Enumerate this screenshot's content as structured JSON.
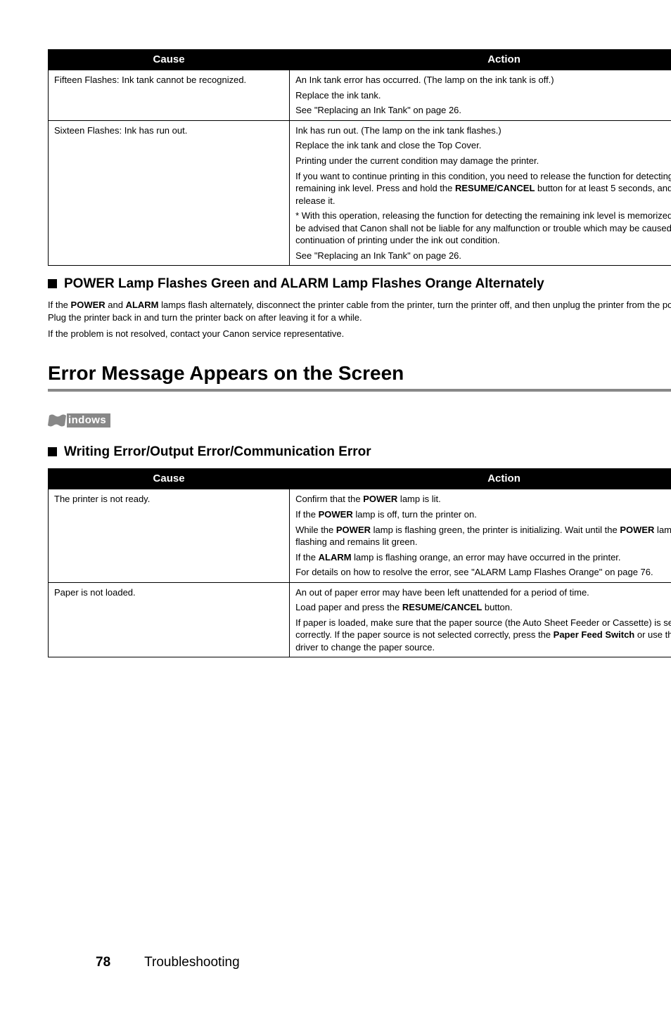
{
  "tables": {
    "t1": {
      "headers": {
        "cause": "Cause",
        "action": "Action"
      },
      "rows": [
        {
          "cause": "Fifteen Flashes: Ink tank cannot be recognized.",
          "action_lines": [
            "An Ink tank error has occurred. (The lamp on the ink tank is off.)",
            "Replace the ink tank.",
            "See \"Replacing an Ink Tank\" on page 26."
          ]
        },
        {
          "cause": "Sixteen Flashes: Ink has run out.",
          "action_html": [
            "Ink has run out. (The lamp on the ink tank flashes.)",
            "Replace the ink tank and close the Top Cover.",
            "Printing under the current condition may damage the printer.",
            "If you want to continue printing in this condition, you need to release the function for detecting the remaining ink level. Press and hold the <b>RESUME/CANCEL</b> button for at least 5 seconds, and then release it.",
            "* With this operation, releasing the function for detecting the remaining ink level is memorized. Please be advised that Canon shall not be liable for any malfunction or trouble which may be caused by continuation of printing under the ink out condition.",
            "See \"Replacing an Ink Tank\" on page 26."
          ]
        }
      ]
    },
    "t2": {
      "headers": {
        "cause": "Cause",
        "action": "Action"
      },
      "rows": [
        {
          "cause": "The printer is not ready.",
          "action_html": [
            "Confirm that the <b>POWER</b> lamp is lit.",
            "If the <b>POWER</b> lamp is off, turn the printer on.",
            "While the <b>POWER</b> lamp is flashing green, the printer is initializing. Wait until the <b>POWER</b> lamp stops flashing and remains lit green.",
            "If the <b>ALARM</b> lamp is flashing orange, an error may have occurred in the printer.",
            "For details on how to resolve the error, see \"ALARM Lamp Flashes Orange\" on page 76."
          ]
        },
        {
          "cause": "Paper is not loaded.",
          "action_html": [
            "An out of paper error may have been left unattended for a period of time.",
            "Load paper and press the <b>RESUME/CANCEL</b> button.",
            "If paper is loaded, make sure that the paper source (the Auto Sheet Feeder or Cassette) is selected correctly. If the paper source is not selected correctly, press the <b>Paper Feed Switch</b> or use the printer driver to change the paper source."
          ]
        }
      ]
    }
  },
  "headings": {
    "sub1": "POWER Lamp Flashes Green and ALARM Lamp Flashes Orange Alternately",
    "sub2": "Writing Error/Output Error/Communication Error",
    "section": "Error Message Appears on the Screen"
  },
  "paragraphs": {
    "p1_html": "If the <b>POWER</b> and <b>ALARM</b> lamps flash alternately, disconnect the printer cable from the printer, turn the printer off, and then unplug the printer from the power supply. Plug the printer back in and turn the printer back on after leaving it for a while.",
    "p2": "If the problem is not resolved, contact your Canon service representative."
  },
  "os_label": "indows",
  "footer": {
    "page": "78",
    "section": "Troubleshooting"
  }
}
